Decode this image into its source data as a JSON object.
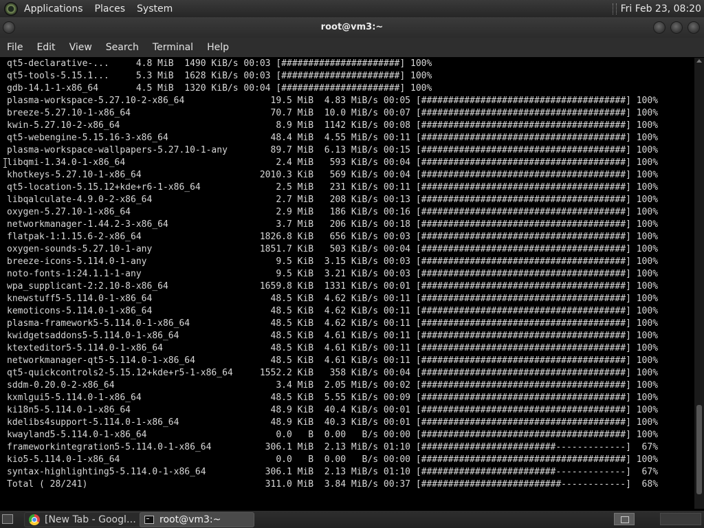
{
  "top_panel": {
    "menus": [
      "Applications",
      "Places",
      "System"
    ],
    "clock": "Fri Feb 23, 08:20"
  },
  "window": {
    "title": "root@vm3:~",
    "menubar": [
      "File",
      "Edit",
      "View",
      "Search",
      "Terminal",
      "Help"
    ]
  },
  "terminal": {
    "lines": [
      "qt5-declarative-...     4.8 MiB  1490 KiB/s 00:03 [######################] 100%",
      "qt5-tools-5.15.1...     5.3 MiB  1628 KiB/s 00:03 [######################] 100%",
      "gdb-14.1-1-x86_64       4.5 MiB  1320 KiB/s 00:04 [######################] 100%",
      "plasma-workspace-5.27.10-2-x86_64                19.5 MiB  4.83 MiB/s 00:05 [######################################] 100%",
      "breeze-5.27.10-1-x86_64                          70.7 MiB  10.0 MiB/s 00:07 [######################################] 100%",
      "kwin-5.27.10-2-x86_64                             8.9 MiB  1142 KiB/s 00:08 [######################################] 100%",
      "qt5-webengine-5.15.16-3-x86_64                   48.4 MiB  4.55 MiB/s 00:11 [######################################] 100%",
      "plasma-workspace-wallpapers-5.27.10-1-any        89.7 MiB  6.13 MiB/s 00:15 [######################################] 100%",
      "libqmi-1.34.0-1-x86_64                            2.4 MiB   593 KiB/s 00:04 [######################################] 100%",
      "khotkeys-5.27.10-1-x86_64                      2010.3 KiB   569 KiB/s 00:04 [######################################] 100%",
      "qt5-location-5.15.12+kde+r6-1-x86_64              2.5 MiB   231 KiB/s 00:11 [######################################] 100%",
      "libqalculate-4.9.0-2-x86_64                       2.7 MiB   208 KiB/s 00:13 [######################################] 100%",
      "oxygen-5.27.10-1-x86_64                           2.9 MiB   186 KiB/s 00:16 [######################################] 100%",
      "networkmanager-1.44.2-3-x86_64                    3.7 MiB   206 KiB/s 00:18 [######################################] 100%",
      "flatpak-1:1.15.6-2-x86_64                      1826.8 KiB   656 KiB/s 00:03 [######################################] 100%",
      "oxygen-sounds-5.27.10-1-any                    1851.7 KiB   503 KiB/s 00:04 [######################################] 100%",
      "breeze-icons-5.114.0-1-any                        9.5 KiB  3.15 KiB/s 00:03 [######################################] 100%",
      "noto-fonts-1:24.1.1-1-any                         9.5 KiB  3.21 KiB/s 00:03 [######################################] 100%",
      "wpa_supplicant-2:2.10-8-x86_64                 1659.8 KiB  1331 KiB/s 00:01 [######################################] 100%",
      "knewstuff5-5.114.0-1-x86_64                      48.5 KiB  4.62 KiB/s 00:11 [######################################] 100%",
      "kemoticons-5.114.0-1-x86_64                      48.5 KiB  4.62 KiB/s 00:11 [######################################] 100%",
      "plasma-framework5-5.114.0-1-x86_64               48.5 KiB  4.62 KiB/s 00:11 [######################################] 100%",
      "kwidgetsaddons5-5.114.0-1-x86_64                 48.5 KiB  4.61 KiB/s 00:11 [######################################] 100%",
      "ktexteditor5-5.114.0-1-x86_64                    48.5 KiB  4.61 KiB/s 00:11 [######################################] 100%",
      "networkmanager-qt5-5.114.0-1-x86_64              48.5 KiB  4.61 KiB/s 00:11 [######################################] 100%",
      "qt5-quickcontrols2-5.15.12+kde+r5-1-x86_64     1552.2 KiB   358 KiB/s 00:04 [######################################] 100%",
      "sddm-0.20.0-2-x86_64                              3.4 MiB  2.05 MiB/s 00:02 [######################################] 100%",
      "kxmlgui5-5.114.0-1-x86_64                        48.5 KiB  5.55 KiB/s 00:09 [######################################] 100%",
      "ki18n5-5.114.0-1-x86_64                          48.9 KiB  40.4 KiB/s 00:01 [######################################] 100%",
      "kdelibs4support-5.114.0-1-x86_64                 48.9 KiB  40.3 KiB/s 00:01 [######################################] 100%",
      "kwayland5-5.114.0-1-x86_64                        0.0   B  0.00   B/s 00:00 [######################################] 100%",
      "frameworkintegration5-5.114.0-1-x86_64          306.1 MiB  2.13 MiB/s 01:10 [#########################-------------]  67%",
      "kio5-5.114.0-1-x86_64                             0.0   B  0.00   B/s 00:00 [######################################] 100%",
      "syntax-highlighting5-5.114.0-1-x86_64           306.1 MiB  2.13 MiB/s 01:10 [#########################-------------]  67%",
      "Total ( 28/241)                                 311.0 MiB  3.84 MiB/s 00:37 [##########################------------]  68%"
    ]
  },
  "taskbar": {
    "tasks": [
      {
        "label": "[New Tab - Google ...",
        "icon": "chrome-icon"
      },
      {
        "label": "root@vm3:~",
        "icon": "terminal-icon"
      }
    ]
  }
}
